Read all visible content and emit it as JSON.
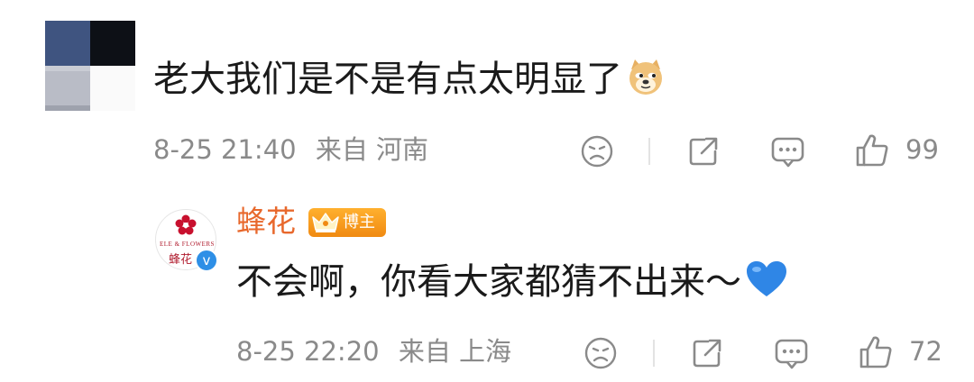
{
  "comments": [
    {
      "text": "老大我们是不是有点太明显了",
      "emoji": "doge-emoji",
      "date": "8-25 21:40",
      "location": "来自 河南",
      "likes": "99"
    },
    {
      "author": "蜂花",
      "badge": "博主",
      "avatar_text_en": "ELE & FLOWERS",
      "avatar_text_cn": "蜂花",
      "text": "不会啊，你看大家都猜不出来～",
      "emoji": "blue-heart-emoji",
      "date": "8-25 22:20",
      "location": "来自 上海",
      "likes": "72"
    }
  ],
  "colors": {
    "author": "#e8682c",
    "meta": "#8a8a8a",
    "badge": "#f5a623",
    "verified": "#2e8fe6",
    "heart": "#2f86e6"
  }
}
